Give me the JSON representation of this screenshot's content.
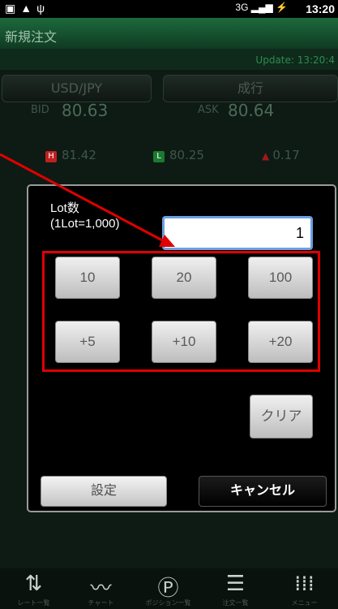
{
  "status_bar": {
    "left_icons": [
      "screenshot-icon",
      "warning-icon",
      "usb-icon"
    ],
    "network": "3G",
    "time": "13:20"
  },
  "header": {
    "title": "新規注文"
  },
  "update": {
    "text": "Update: 13:20:4"
  },
  "selectors": {
    "pair": "USD/JPY",
    "order_type": "成行"
  },
  "quotes": {
    "bid_label": "BID",
    "bid_value": "80.63",
    "ask_label": "ASK",
    "ask_value": "80.64",
    "high_badge": "H",
    "high_value": "81.42",
    "low_badge": "L",
    "low_value": "80.25",
    "change_value": "0.17"
  },
  "dialog": {
    "lot_label_line1": "Lot数",
    "lot_label_line2": "(1Lot=1,000)",
    "lot_value": "1",
    "quick_buttons": [
      "10",
      "20",
      "100",
      "+5",
      "+10",
      "+20"
    ],
    "clear_label": "クリア",
    "set_label": "設定",
    "cancel_label": "キャンセル"
  },
  "nav": [
    {
      "label": "レート一覧",
      "icon": "rate-list-icon"
    },
    {
      "label": "チャート",
      "icon": "chart-icon"
    },
    {
      "label": "ポジション一覧",
      "icon": "position-icon"
    },
    {
      "label": "注文一覧",
      "icon": "order-list-icon"
    },
    {
      "label": "メニュー",
      "icon": "menu-icon"
    }
  ],
  "colors": {
    "highlight": "#e00000",
    "accent_green": "#1d6a3c",
    "up_red": "#e02020",
    "low_green": "#1aa33a"
  }
}
